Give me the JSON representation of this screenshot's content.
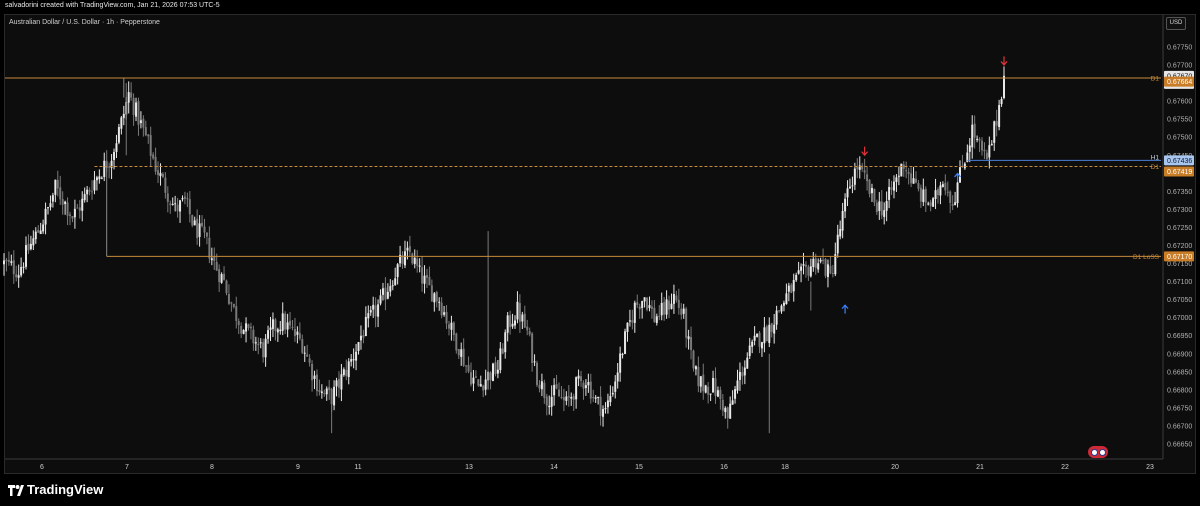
{
  "header": {
    "attribution": "salvadorini created with TradingView.com, Jan 21, 2026 07:53 UTC-5"
  },
  "footer": {
    "brand": "TradingView"
  },
  "currency_label": "USD",
  "colors": {
    "background": "#0d0d0d",
    "candle_up": "#e8e8e8",
    "candle_down": "#7a7a7a",
    "level_orange": "#c78a3a",
    "level_blue": "#4a7fd4",
    "arrow_red": "#e0343c",
    "arrow_blue": "#3a82ff",
    "text_dim": "#b0b0b0"
  },
  "chart_data": {
    "type": "candlestick",
    "title": "Australian Dollar / U.S. Dollar · 1h · Pepperstone",
    "x_ticks": [
      "6",
      "7",
      "8",
      "9",
      "11",
      "13",
      "14",
      "15",
      "16",
      "18",
      "20",
      "21",
      "22",
      "23"
    ],
    "y_ticks": [
      0.6665,
      0.667,
      0.6675,
      0.668,
      0.6685,
      0.669,
      0.6695,
      0.67,
      0.6705,
      0.671,
      0.6715,
      0.672,
      0.6725,
      0.673,
      0.6735,
      0.674,
      0.6745,
      0.675,
      0.6755,
      0.676,
      0.6765,
      0.677,
      0.6775
    ],
    "y_tick_labels": [
      "0.66650",
      "0.66700",
      "0.66750",
      "0.66800",
      "0.66850",
      "0.66900",
      "0.66950",
      "0.67000",
      "0.67050",
      "0.67100",
      "0.67150",
      "0.67200",
      "0.67250",
      "0.67300",
      "0.67350",
      "0.67400",
      "0.67450",
      "0.67500",
      "0.67550",
      "0.67600",
      "0.67650",
      "0.67700",
      "0.67750"
    ],
    "ylim": [
      0.66615,
      0.67775
    ],
    "price_path": [
      {
        "x": 0,
        "y": 0.6715
      },
      {
        "x": 6,
        "y": 0.6713
      },
      {
        "x": 10,
        "y": 0.6719
      },
      {
        "x": 14,
        "y": 0.6724
      },
      {
        "x": 18,
        "y": 0.673
      },
      {
        "x": 21,
        "y": 0.6736
      },
      {
        "x": 24,
        "y": 0.6733
      },
      {
        "x": 28,
        "y": 0.6728
      },
      {
        "x": 32,
        "y": 0.6732
      },
      {
        "x": 36,
        "y": 0.6737
      },
      {
        "x": 40,
        "y": 0.6741
      },
      {
        "x": 44,
        "y": 0.6745
      },
      {
        "x": 48,
        "y": 0.6754
      },
      {
        "x": 51,
        "y": 0.6762
      },
      {
        "x": 54,
        "y": 0.6757
      },
      {
        "x": 58,
        "y": 0.675
      },
      {
        "x": 62,
        "y": 0.6742
      },
      {
        "x": 66,
        "y": 0.6736
      },
      {
        "x": 70,
        "y": 0.673
      },
      {
        "x": 74,
        "y": 0.6732
      },
      {
        "x": 78,
        "y": 0.6725
      },
      {
        "x": 82,
        "y": 0.6722
      },
      {
        "x": 86,
        "y": 0.6715
      },
      {
        "x": 90,
        "y": 0.671
      },
      {
        "x": 94,
        "y": 0.6702
      },
      {
        "x": 98,
        "y": 0.6697
      },
      {
        "x": 102,
        "y": 0.6694
      },
      {
        "x": 106,
        "y": 0.6691
      },
      {
        "x": 110,
        "y": 0.6697
      },
      {
        "x": 114,
        "y": 0.6699
      },
      {
        "x": 118,
        "y": 0.6696
      },
      {
        "x": 122,
        "y": 0.6693
      },
      {
        "x": 126,
        "y": 0.6685
      },
      {
        "x": 130,
        "y": 0.6679
      },
      {
        "x": 134,
        "y": 0.6678
      },
      {
        "x": 138,
        "y": 0.6683
      },
      {
        "x": 142,
        "y": 0.6688
      },
      {
        "x": 146,
        "y": 0.6695
      },
      {
        "x": 150,
        "y": 0.67
      },
      {
        "x": 154,
        "y": 0.6704
      },
      {
        "x": 158,
        "y": 0.671
      },
      {
        "x": 162,
        "y": 0.6715
      },
      {
        "x": 166,
        "y": 0.6718
      },
      {
        "x": 170,
        "y": 0.6712
      },
      {
        "x": 174,
        "y": 0.6708
      },
      {
        "x": 178,
        "y": 0.6705
      },
      {
        "x": 182,
        "y": 0.6698
      },
      {
        "x": 186,
        "y": 0.6692
      },
      {
        "x": 190,
        "y": 0.6685
      },
      {
        "x": 194,
        "y": 0.6681
      },
      {
        "x": 198,
        "y": 0.6684
      },
      {
        "x": 202,
        "y": 0.6686
      },
      {
        "x": 206,
        "y": 0.6698
      },
      {
        "x": 210,
        "y": 0.6702
      },
      {
        "x": 214,
        "y": 0.6696
      },
      {
        "x": 218,
        "y": 0.6684
      },
      {
        "x": 222,
        "y": 0.6678
      },
      {
        "x": 226,
        "y": 0.6679
      },
      {
        "x": 230,
        "y": 0.6676
      },
      {
        "x": 234,
        "y": 0.6681
      },
      {
        "x": 238,
        "y": 0.6683
      },
      {
        "x": 242,
        "y": 0.6677
      },
      {
        "x": 246,
        "y": 0.6674
      },
      {
        "x": 250,
        "y": 0.6683
      },
      {
        "x": 254,
        "y": 0.6694
      },
      {
        "x": 258,
        "y": 0.6703
      },
      {
        "x": 262,
        "y": 0.6706
      },
      {
        "x": 266,
        "y": 0.67
      },
      {
        "x": 270,
        "y": 0.6702
      },
      {
        "x": 274,
        "y": 0.6706
      },
      {
        "x": 278,
        "y": 0.67
      },
      {
        "x": 282,
        "y": 0.6685
      },
      {
        "x": 286,
        "y": 0.6681
      },
      {
        "x": 290,
        "y": 0.6681
      },
      {
        "x": 294,
        "y": 0.6676
      },
      {
        "x": 296,
        "y": 0.6672
      },
      {
        "x": 300,
        "y": 0.6682
      },
      {
        "x": 304,
        "y": 0.6689
      },
      {
        "x": 308,
        "y": 0.6694
      },
      {
        "x": 312,
        "y": 0.6696
      },
      {
        "x": 316,
        "y": 0.6701
      },
      {
        "x": 320,
        "y": 0.6706
      },
      {
        "x": 324,
        "y": 0.671
      },
      {
        "x": 328,
        "y": 0.6713
      },
      {
        "x": 332,
        "y": 0.6716
      },
      {
        "x": 335,
        "y": 0.6715
      },
      {
        "x": 338,
        "y": 0.6711
      },
      {
        "x": 340,
        "y": 0.6718
      },
      {
        "x": 343,
        "y": 0.6728
      },
      {
        "x": 346,
        "y": 0.6737
      },
      {
        "x": 349,
        "y": 0.6742
      },
      {
        "x": 352,
        "y": 0.6738
      },
      {
        "x": 356,
        "y": 0.6732
      },
      {
        "x": 360,
        "y": 0.673
      },
      {
        "x": 364,
        "y": 0.6737
      },
      {
        "x": 368,
        "y": 0.6743
      },
      {
        "x": 372,
        "y": 0.6737
      },
      {
        "x": 376,
        "y": 0.6733
      },
      {
        "x": 380,
        "y": 0.6731
      },
      {
        "x": 384,
        "y": 0.6739
      },
      {
        "x": 388,
        "y": 0.6732
      },
      {
        "x": 392,
        "y": 0.6742
      },
      {
        "x": 396,
        "y": 0.6752
      },
      {
        "x": 399,
        "y": 0.6747
      },
      {
        "x": 402,
        "y": 0.6743
      },
      {
        "x": 406,
        "y": 0.6755
      },
      {
        "x": 409,
        "y": 0.6767
      }
    ],
    "levels": [
      {
        "label": "D1",
        "price": 0.67664,
        "price_label": "0.67664",
        "style": "solid",
        "color": "#c78a3a"
      },
      {
        "label": "H1",
        "price": 0.67436,
        "price_label": "0.67436",
        "style": "solid",
        "color": "#4a7fd4"
      },
      {
        "label": "D1",
        "price": 0.67419,
        "price_label": "0.67419",
        "style": "dashed",
        "color": "#c78a3a"
      },
      {
        "label": "D1 LoSS",
        "price": 0.6717,
        "price_label": "0.67170",
        "style": "solid",
        "color": "#c78a3a"
      }
    ],
    "current_price": {
      "price": 0.6767,
      "price_label": "0.67670",
      "countdown": "06:44"
    },
    "markers": [
      {
        "type": "down-arrow",
        "color": "#e0343c",
        "x": 409,
        "price": 0.6771
      },
      {
        "type": "down-arrow",
        "color": "#e0343c",
        "x": 352,
        "price": 0.6746
      },
      {
        "type": "up-arrow",
        "color": "#3a82ff",
        "x": 344,
        "price": 0.67025
      },
      {
        "type": "up-arrow",
        "color": "#3a82ff",
        "x": 390,
        "price": 0.6739
      }
    ]
  }
}
